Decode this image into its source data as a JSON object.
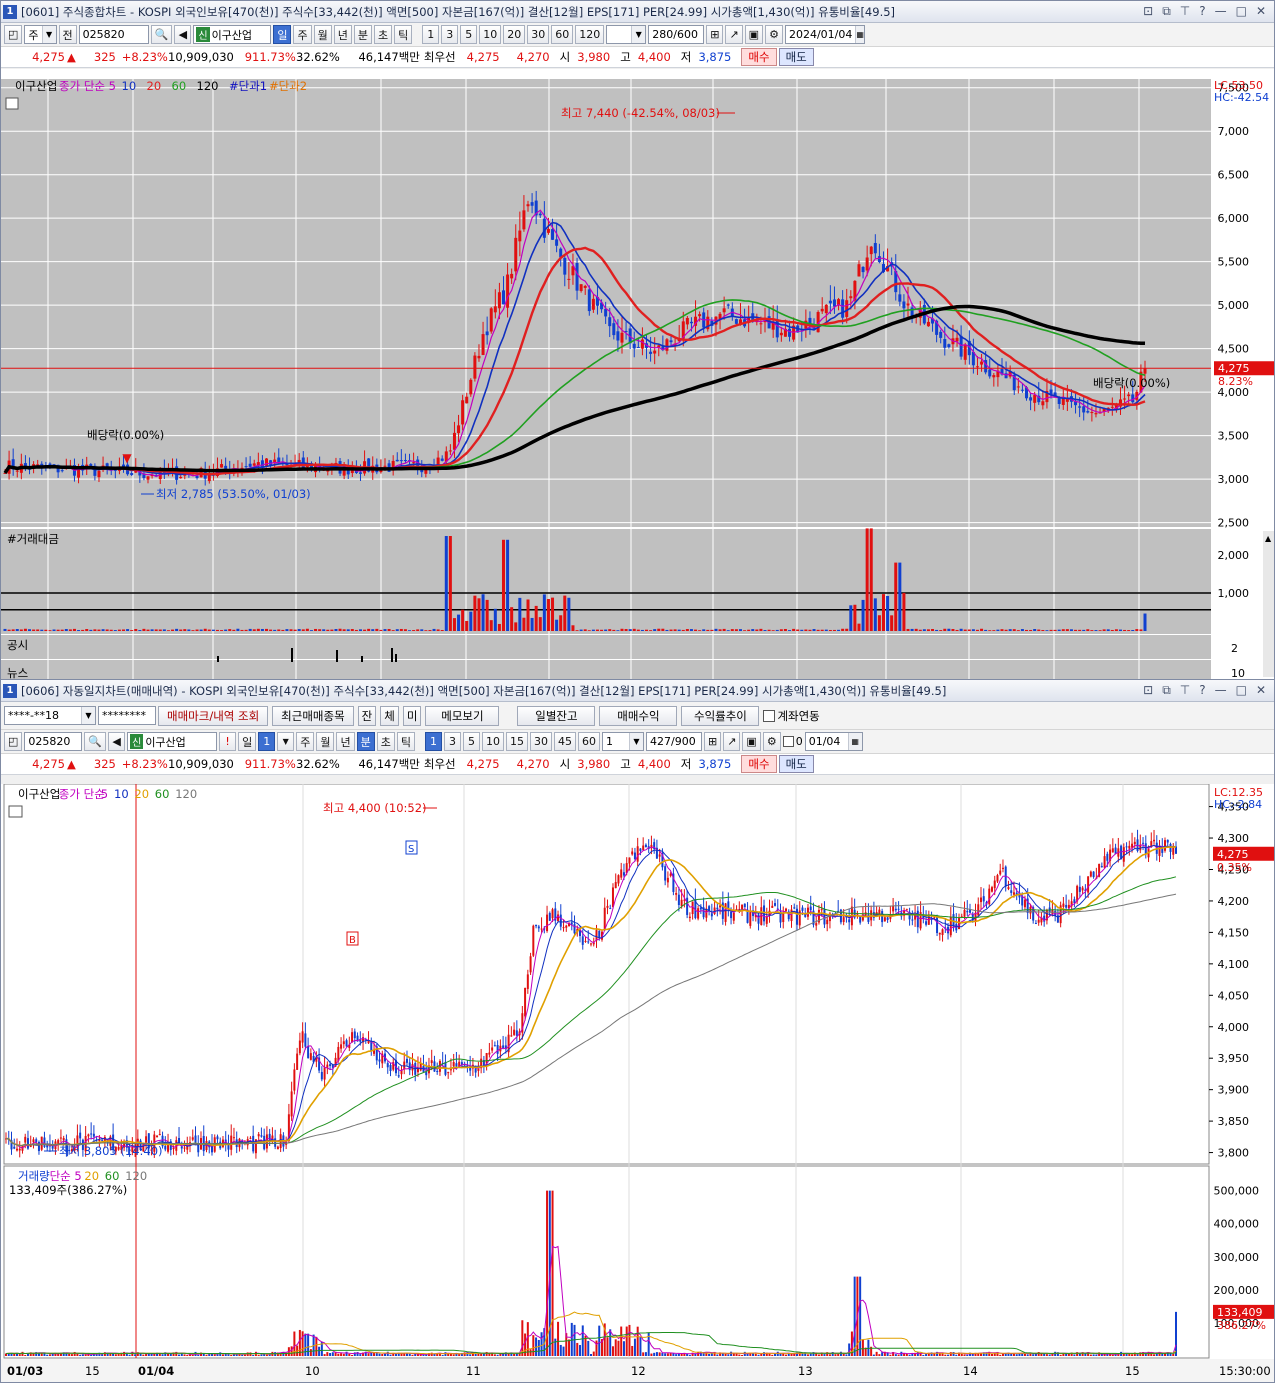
{
  "win1": {
    "num": "1",
    "title": "[0601] 주식종합차트 - KOSPI 외국인보유[470(천)] 주식수[33,442(천)] 액면[500] 자본금[167(억)] 결산[12월] EPS[171] PER[24.99] 시가총액[1,430(억)] 유통비율[49.5]",
    "toolbar": {
      "period": "주",
      "prev": "전",
      "code": "025820",
      "name": "이구산업",
      "tabs": [
        "일",
        "주",
        "월",
        "년",
        "분",
        "초",
        "틱"
      ],
      "nums": [
        "1",
        "3",
        "5",
        "10",
        "20",
        "30",
        "60",
        "120"
      ],
      "count": "280",
      "total": "/600",
      "date": "2024/01/04"
    },
    "quote": {
      "price": "4,275",
      "change": "325",
      "pct": "+8.23%",
      "volume": "10,909,030",
      "vol_pct": "911.73%",
      "turnover": "32.62%",
      "amount": "46,147백만",
      "bid_label": "최우선",
      "bid1": "4,275",
      "bid2": "4,270",
      "open_label": "시",
      "open": "3,980",
      "high_label": "고",
      "high": "4,400",
      "low_label": "저",
      "low": "3,875",
      "buy": "매수",
      "sell": "매도"
    },
    "legend": {
      "name": "이구산업",
      "ma": "종가 단순 5",
      "m10": "10",
      "m20": "20",
      "m60": "60",
      "m120": "120",
      "d1": "#단과1",
      "d2": "#단과2"
    },
    "lc": "LC:53.50",
    "hc": "HC:-42.54",
    "y_ticks": [
      "7,500",
      "7,000",
      "6,500",
      "6,000",
      "5,500",
      "5,000",
      "4,500",
      "4,000",
      "3,500",
      "3,000",
      "2,500"
    ],
    "price_tag": "4,275",
    "price_tag_pct": "8.23%",
    "ann_high": "최고 7,440 (-42.54%, 08/03)",
    "ann_low": "최저 2,785 (53.50%, 01/03)",
    "ann_div1": "배당락(0.00%)",
    "ann_div2": "배당락(0.00%)",
    "vol_title": "#거래대금",
    "vol_ticks": [
      "2,000",
      "1,000"
    ],
    "pub_title": "공시",
    "pub_tick": "2",
    "news_title": "뉴스",
    "news_tick": "10"
  },
  "win2": {
    "num": "1",
    "title": "[0606] 자동일지차트(매매내역) - KOSPI 외국인보유[470(천)] 주식수[33,442(천)] 액면[500] 자본금[167(억)] 결산[12월] EPS[171] PER[24.99] 시가총액[1,430(억)] 유통비율[49.5]",
    "acct": "****-**18",
    "pw": "********",
    "buttons": [
      "매매마크/내역 조회",
      "최근매매종목",
      "잔",
      "체",
      "미",
      "메모보기",
      "일별잔고",
      "매매수익",
      "수익률추이"
    ],
    "link": "계좌연동",
    "toolbar": {
      "code": "025820",
      "name": "이구산업",
      "tabs": [
        "일",
        "1",
        "주",
        "월",
        "년",
        "분",
        "초",
        "틱"
      ],
      "nums": [
        "1",
        "3",
        "5",
        "10",
        "15",
        "30",
        "45",
        "60"
      ],
      "sel": "1",
      "count": "427",
      "total": "/900",
      "zero": "0",
      "date": "01/04"
    },
    "legend": {
      "name": "이구산업",
      "ma": "종가 단순",
      "m5": "5",
      "m10": "10",
      "m20": "20",
      "m60": "60",
      "m120": "120"
    },
    "lc": "LC:12.35",
    "hc": "HC:-2.84",
    "y_ticks": [
      "4,350",
      "4,300",
      "4,250",
      "4,200",
      "4,150",
      "4,100",
      "4,050",
      "4,000",
      "3,950",
      "3,900",
      "3,850",
      "3,800"
    ],
    "price_tag": "4,275",
    "price_tag_pct": "0.35%",
    "ann_high": "최고 4,400 (10:52)",
    "ann_low": "최저 3,805 (14:40)",
    "vol_legend": {
      "name": "거래량",
      "ma": "단순 5",
      "m20": "20",
      "m60": "60",
      "m120": "120"
    },
    "vol_value": "133,409주(386.27%)",
    "vol_ticks": [
      "500,000",
      "400,000",
      "300,000",
      "200,000",
      "100,000"
    ],
    "vol_tag": "133,409",
    "vol_tag_pct": "386.27%",
    "x_labels": [
      "01/03",
      "15",
      "01/04",
      "10",
      "11",
      "12",
      "13",
      "14",
      "15"
    ],
    "time": "15:30:00"
  },
  "colors": {
    "up": "#e01010",
    "down": "#1040d0",
    "ma5": "#c000c0",
    "ma10": "#1030c0",
    "ma20": "#e02020",
    "ma60": "#20a020",
    "ma120": "#000000",
    "bg": "#c0c0c0"
  }
}
